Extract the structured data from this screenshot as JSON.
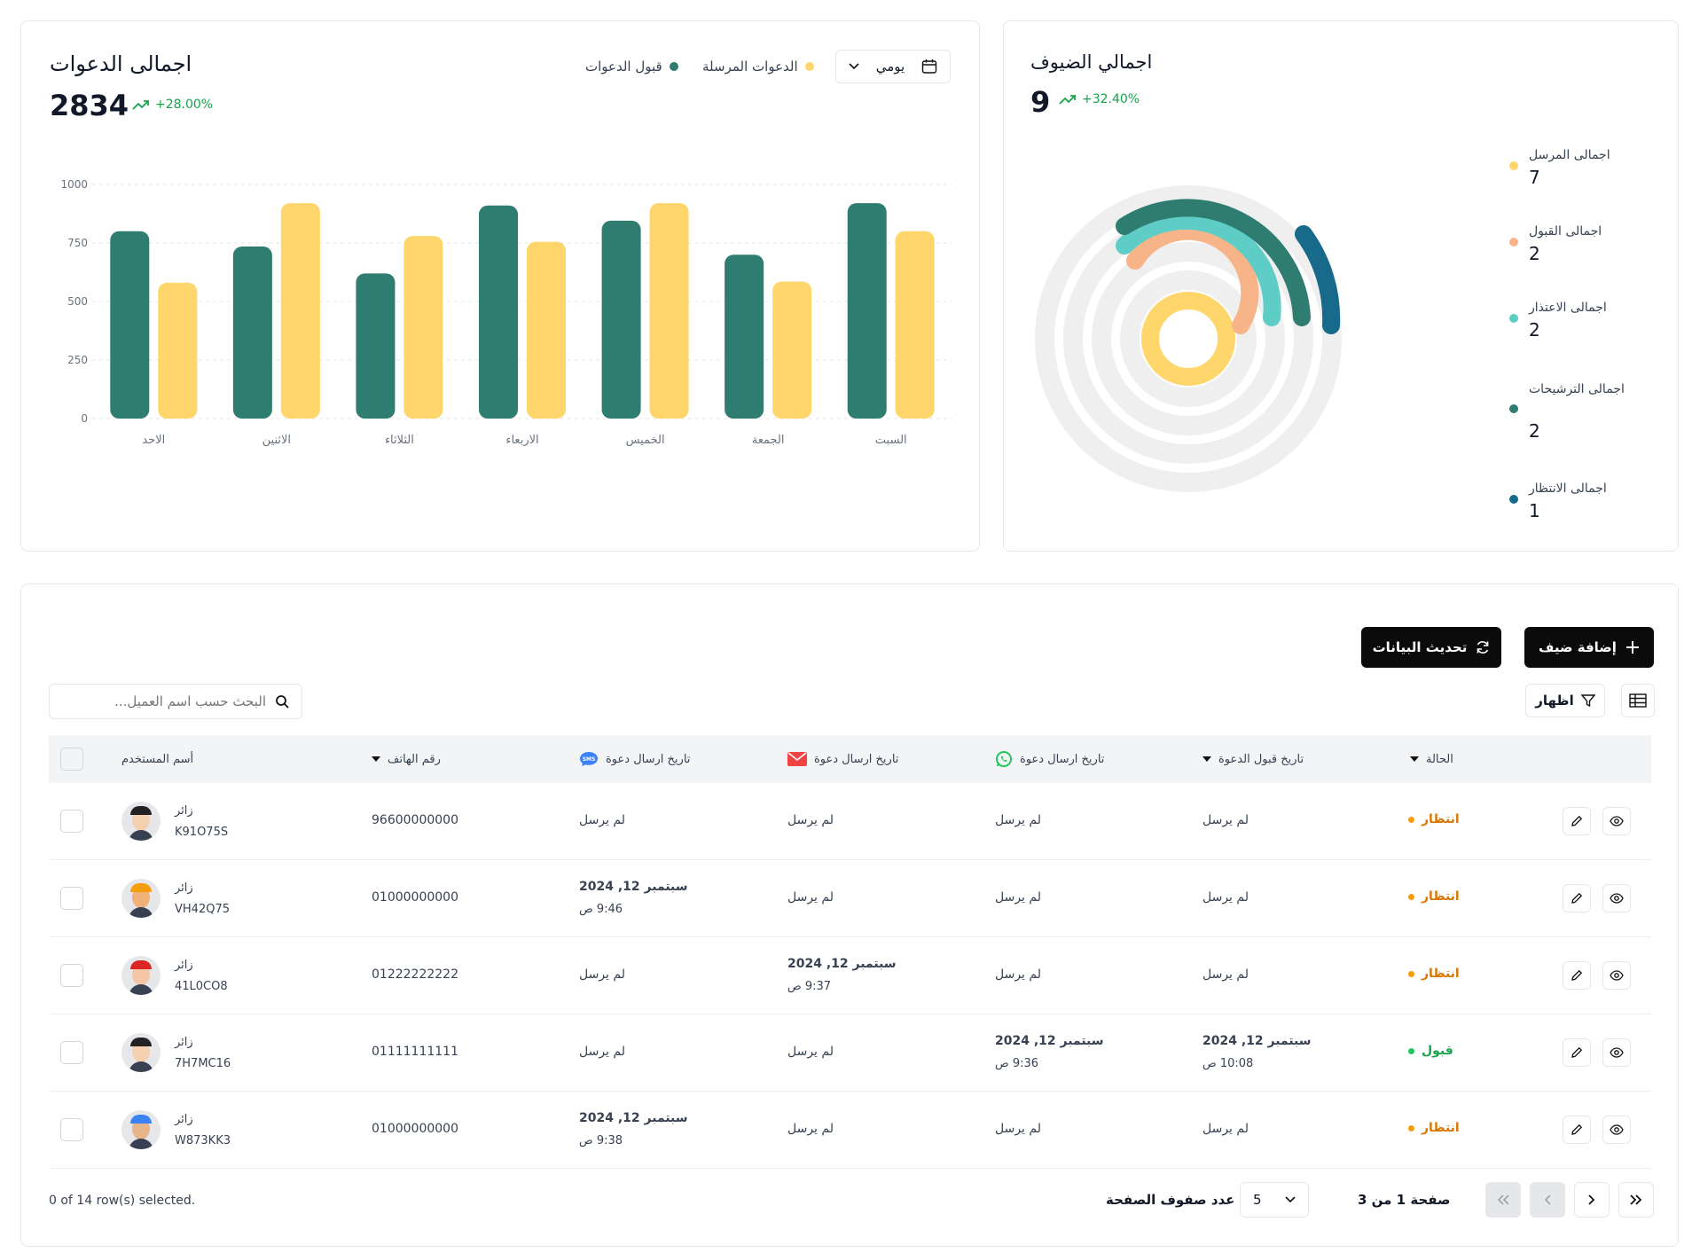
{
  "invites_card": {
    "title": "اجمالى الدعوات",
    "total": "2834",
    "change": "+28.00%",
    "period_select": "يومي",
    "legend": [
      {
        "label": "قبول الدعوات",
        "color": "#2e7d70"
      },
      {
        "label": "الدعوات المرسلة",
        "color": "#ffd66b"
      }
    ]
  },
  "chart_data": {
    "type": "bar",
    "categories": [
      "الاحد",
      "الاثنين",
      "الثلاثاء",
      "الاربعاء",
      "الخميس",
      "الجمعة",
      "السبت"
    ],
    "series": [
      {
        "name": "قبول الدعوات",
        "color": "#2e7d70",
        "values": [
          800,
          735,
          620,
          910,
          845,
          700,
          920
        ]
      },
      {
        "name": "الدعوات المرسلة",
        "color": "#ffd66b",
        "values": [
          580,
          920,
          780,
          755,
          920,
          585,
          800
        ]
      }
    ],
    "yticks": [
      "1000",
      "750",
      "500",
      "250",
      "0"
    ],
    "ylim": [
      0,
      1000
    ],
    "grid": true
  },
  "guests_card": {
    "title": "اجمالي الضيوف",
    "total": "9",
    "change": "+32.40%",
    "legend": [
      {
        "label": "اجمالى المرسل",
        "value": "7",
        "color": "#ffd66b"
      },
      {
        "label": "اجمالى القبول",
        "value": "2",
        "color": "#f7b489"
      },
      {
        "label": "اجمالى الاعتذار",
        "value": "2",
        "color": "#5ecdc6"
      },
      {
        "label": "اجمالى الترشيحات",
        "value": "2",
        "color": "#2e7d70"
      },
      {
        "label": "اجمالى الانتظار",
        "value": "1",
        "color": "#176a8a"
      }
    ]
  },
  "toolbar": {
    "add_guest": "إضافة ضيف",
    "refresh": "تحديث البيانات",
    "show": "اظهار",
    "search_placeholder": "البحث حسب اسم العميل..."
  },
  "table": {
    "headers": {
      "status": "الحالة",
      "accept_date": "تاريخ قبول الدعوة",
      "whatsapp_date": "تاريخ ارسال دعوة",
      "email_date": "تاريخ ارسال دعوة",
      "sms_date": "تاريخ ارسال دعوة",
      "phone": "رقم الهاتف",
      "username": "أسم المستخدم"
    },
    "rows": [
      {
        "status": "انتظار",
        "status_color": "#d97706",
        "dot": "#f59e0b",
        "accept": "لم يرسل",
        "accept_time": "",
        "whatsapp": "لم يرسل",
        "whatsapp_time": "",
        "email": "لم يرسل",
        "email_time": "",
        "sms": "لم يرسل",
        "sms_time": "",
        "phone": "96600000000",
        "name": "زائر",
        "code": "K91O75S"
      },
      {
        "status": "انتظار",
        "status_color": "#d97706",
        "dot": "#f59e0b",
        "accept": "لم يرسل",
        "accept_time": "",
        "whatsapp": "لم يرسل",
        "whatsapp_time": "",
        "email": "لم يرسل",
        "email_time": "",
        "sms": "سبتمبر 12, 2024",
        "sms_time": "9:46 ص",
        "phone": "01000000000",
        "name": "زائر",
        "code": "VH42Q75"
      },
      {
        "status": "انتظار",
        "status_color": "#d97706",
        "dot": "#f59e0b",
        "accept": "لم يرسل",
        "accept_time": "",
        "whatsapp": "لم يرسل",
        "whatsapp_time": "",
        "email": "سبتمبر 12, 2024",
        "email_time": "9:37 ص",
        "sms": "لم يرسل",
        "sms_time": "",
        "phone": "01222222222",
        "name": "زائر",
        "code": "41L0CO8"
      },
      {
        "status": "قبول",
        "status_color": "#16a34a",
        "dot": "#22c55e",
        "accept": "سبتمبر 12, 2024",
        "accept_time": "10:08 ص",
        "whatsapp": "سبتمبر 12, 2024",
        "whatsapp_time": "9:36 ص",
        "email": "لم يرسل",
        "email_time": "",
        "sms": "لم يرسل",
        "sms_time": "",
        "phone": "01111111111",
        "name": "زائر",
        "code": "7H7MC16"
      },
      {
        "status": "انتظار",
        "status_color": "#d97706",
        "dot": "#f59e0b",
        "accept": "لم يرسل",
        "accept_time": "",
        "whatsapp": "لم يرسل",
        "whatsapp_time": "",
        "email": "لم يرسل",
        "email_time": "",
        "sms": "سبتمبر 12, 2024",
        "sms_time": "9:38 ص",
        "phone": "01000000000",
        "name": "زائر",
        "code": "W873KK3"
      }
    ]
  },
  "footer": {
    "selected": "0 of 14 row(s) selected.",
    "rows_per_page_label": "عدد صفوف الصفحة",
    "rows_per_page": "5",
    "page_info": "صفحة 1 من 3"
  }
}
